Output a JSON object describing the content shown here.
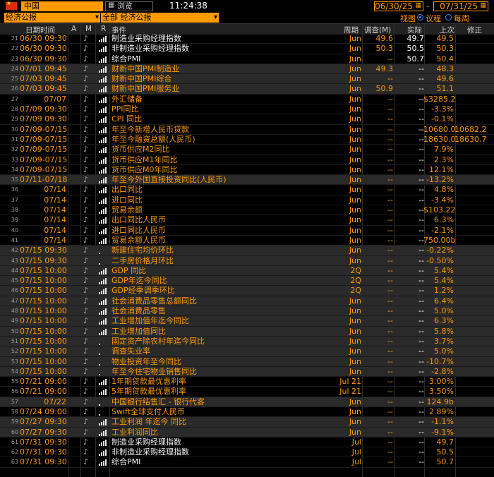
{
  "toolbar": {
    "country": "中国",
    "browse_label": "浏览",
    "time": "11:24:38",
    "date_start": "06/30/25",
    "date_end": "07/31/25",
    "dash": "-",
    "filter_left": "经济公报",
    "filter_right": "全部 经济公报",
    "view_label": "视图",
    "radio_1": "议程",
    "radio_2": "每周"
  },
  "headers": {
    "datetime": "日期时间",
    "a": "A",
    "m": "M",
    "r": "R",
    "event": "事件",
    "period": "周期",
    "survey": "调查(M)",
    "actual": "实际",
    "prior": "上次",
    "revised": "修正"
  },
  "rows": [
    {
      "n": "21",
      "dt": "06/30 09:30",
      "ev": "制造业采购经理指数",
      "c": "w",
      "per": "Jun",
      "sv": "49.6",
      "act": "49.7",
      "prev": "49.5",
      "rev": "",
      "alt": false,
      "bars": true
    },
    {
      "n": "22",
      "dt": "06/30 09:30",
      "ev": "非制造业采购经理指数",
      "c": "w",
      "per": "Jun",
      "sv": "50.3",
      "act": "50.5",
      "prev": "50.3",
      "rev": "",
      "alt": false,
      "bars": true
    },
    {
      "n": "23",
      "dt": "06/30 09:30",
      "ev": "综合PMI",
      "c": "w",
      "per": "Jun",
      "sv": "--",
      "act": "50.7",
      "prev": "50.4",
      "rev": "",
      "alt": false,
      "bars": true
    },
    {
      "n": "24",
      "dt": "07/01 09:45",
      "ev": "财新中国PMI制造业",
      "c": "o",
      "per": "Jun",
      "sv": "49.3",
      "act": "--",
      "prev": "48.3",
      "rev": "",
      "alt": true,
      "bars": true
    },
    {
      "n": "25",
      "dt": "07/03 09:45",
      "ev": "财新中国PMI综合",
      "c": "o",
      "per": "Jun",
      "sv": "--",
      "act": "--",
      "prev": "49.6",
      "rev": "",
      "alt": true,
      "bars": true
    },
    {
      "n": "26",
      "dt": "07/03 09:45",
      "ev": "财新中国PMI服务业",
      "c": "o",
      "per": "Jun",
      "sv": "50.9",
      "act": "--",
      "prev": "51.1",
      "rev": "",
      "alt": true,
      "bars": true
    },
    {
      "n": "27",
      "dt": "07/07",
      "ev": "外汇储备",
      "c": "o",
      "per": "Jun",
      "sv": "--",
      "act": "--",
      "prev": "$3285.2",
      "rev": "",
      "alt": false,
      "bars": true
    },
    {
      "n": "28",
      "dt": "07/09 09:30",
      "ev": "PPI同比",
      "c": "o",
      "per": "Jun",
      "sv": "--",
      "act": "--",
      "prev": "-3.3%",
      "rev": "",
      "alt": false,
      "bars": true
    },
    {
      "n": "29",
      "dt": "07/09 09:30",
      "ev": "CPI 同比",
      "c": "o",
      "per": "Jun",
      "sv": "--",
      "act": "--",
      "prev": "-0.1%",
      "rev": "",
      "alt": false,
      "bars": true
    },
    {
      "n": "30",
      "dt": "07/09-07/15",
      "ev": "年至今新增人民币贷款",
      "c": "o",
      "per": "Jun",
      "sv": "--",
      "act": "--",
      "prev": "10680.0",
      "rev": "10682.2",
      "alt": false,
      "bars": true
    },
    {
      "n": "31",
      "dt": "07/09-07/15",
      "ev": "年至今融资总额(人民币)",
      "c": "o",
      "per": "Jun",
      "sv": "--",
      "act": "--",
      "prev": "18630.0",
      "rev": "18630.7",
      "alt": false,
      "bars": true
    },
    {
      "n": "32",
      "dt": "07/09-07/15",
      "ev": "货币供应M2同比",
      "c": "o",
      "per": "Jun",
      "sv": "--",
      "act": "--",
      "prev": "7.9%",
      "rev": "",
      "alt": false,
      "bars": true
    },
    {
      "n": "33",
      "dt": "07/09-07/15",
      "ev": "货币供应M1年同比",
      "c": "o",
      "per": "Jun",
      "sv": "--",
      "act": "--",
      "prev": "2.3%",
      "rev": "",
      "alt": false,
      "bars": true
    },
    {
      "n": "34",
      "dt": "07/09-07/15",
      "ev": "货币供应M0年同比",
      "c": "o",
      "per": "Jun",
      "sv": "--",
      "act": "--",
      "prev": "12.1%",
      "rev": "",
      "alt": false,
      "bars": true
    },
    {
      "n": "35",
      "dt": "07/11-07/18",
      "ev": "年至今外国直接投资同比(人民币)",
      "c": "o",
      "per": "Jun",
      "sv": "--",
      "act": "--",
      "prev": "-13.2%",
      "rev": "",
      "alt": true,
      "bars": true
    },
    {
      "n": "36",
      "dt": "07/14",
      "ev": "出口同比",
      "c": "o",
      "per": "Jun",
      "sv": "--",
      "act": "--",
      "prev": "4.8%",
      "rev": "",
      "alt": false,
      "bars": true
    },
    {
      "n": "37",
      "dt": "07/14",
      "ev": "进口同比",
      "c": "o",
      "per": "Jun",
      "sv": "--",
      "act": "--",
      "prev": "-3.4%",
      "rev": "",
      "alt": false,
      "bars": true
    },
    {
      "n": "38",
      "dt": "07/14",
      "ev": "贸易余额",
      "c": "o",
      "per": "Jun",
      "sv": "--",
      "act": "--",
      "prev": "$103.22",
      "rev": "",
      "alt": false,
      "bars": true
    },
    {
      "n": "39",
      "dt": "07/14",
      "ev": "出口同比人民币",
      "c": "o",
      "per": "Jun",
      "sv": "--",
      "act": "--",
      "prev": "6.3%",
      "rev": "",
      "alt": false,
      "bars": true
    },
    {
      "n": "40",
      "dt": "07/14",
      "ev": "进口同比人民币",
      "c": "o",
      "per": "Jun",
      "sv": "--",
      "act": "--",
      "prev": "-2.1%",
      "rev": "",
      "alt": false,
      "bars": true
    },
    {
      "n": "41",
      "dt": "07/14",
      "ev": "贸易余额人民币",
      "c": "o",
      "per": "Jun",
      "sv": "--",
      "act": "--",
      "prev": "750.00b",
      "rev": "",
      "alt": false,
      "bars": true
    },
    {
      "n": "42",
      "dt": "07/15 09:30",
      "ev": "新建住宅均价环比",
      "c": "o",
      "per": "Jun",
      "sv": "--",
      "act": "--",
      "prev": "-0.22%",
      "rev": "",
      "alt": true,
      "bars": false
    },
    {
      "n": "43",
      "dt": "07/15 09:30",
      "ev": "二手房价格月环比",
      "c": "o",
      "per": "Jun",
      "sv": "--",
      "act": "--",
      "prev": "-0.50%",
      "rev": "",
      "alt": true,
      "bars": false
    },
    {
      "n": "44",
      "dt": "07/15 10:00",
      "ev": "GDP 同比",
      "c": "o",
      "per": "2Q",
      "sv": "--",
      "act": "--",
      "prev": "5.4%",
      "rev": "",
      "alt": true,
      "bars": true
    },
    {
      "n": "45",
      "dt": "07/15 10:00",
      "ev": "GDP年迄今同比",
      "c": "o",
      "per": "2Q",
      "sv": "--",
      "act": "--",
      "prev": "5.4%",
      "rev": "",
      "alt": true,
      "bars": true
    },
    {
      "n": "46",
      "dt": "07/15 10:00",
      "ev": "GDP经季调季环比",
      "c": "o",
      "per": "2Q",
      "sv": "--",
      "act": "--",
      "prev": "1.2%",
      "rev": "",
      "alt": true,
      "bars": true
    },
    {
      "n": "47",
      "dt": "07/15 10:00",
      "ev": "社会消费品零售总额同比",
      "c": "o",
      "per": "Jun",
      "sv": "--",
      "act": "--",
      "prev": "6.4%",
      "rev": "",
      "alt": true,
      "bars": true
    },
    {
      "n": "48",
      "dt": "07/15 10:00",
      "ev": "社会消费品零售",
      "c": "o",
      "per": "Jun",
      "sv": "--",
      "act": "--",
      "prev": "5.0%",
      "rev": "",
      "alt": true,
      "bars": true
    },
    {
      "n": "49",
      "dt": "07/15 10:00",
      "ev": "工业增加值年迄今同比",
      "c": "o",
      "per": "Jun",
      "sv": "--",
      "act": "--",
      "prev": "6.3%",
      "rev": "",
      "alt": true,
      "bars": true
    },
    {
      "n": "50",
      "dt": "07/15 10:00",
      "ev": "工业增加值同比",
      "c": "o",
      "per": "Jun",
      "sv": "--",
      "act": "--",
      "prev": "5.8%",
      "rev": "",
      "alt": true,
      "bars": true
    },
    {
      "n": "51",
      "dt": "07/15 10:00",
      "ev": "固定资产除农村年迄今同比",
      "c": "o",
      "per": "Jun",
      "sv": "--",
      "act": "--",
      "prev": "3.7%",
      "rev": "",
      "alt": true,
      "bars": false
    },
    {
      "n": "52",
      "dt": "07/15 10:00",
      "ev": "调查失业率",
      "c": "o",
      "per": "Jun",
      "sv": "--",
      "act": "--",
      "prev": "5.0%",
      "rev": "",
      "alt": true,
      "bars": false
    },
    {
      "n": "53",
      "dt": "07/15 10:00",
      "ev": "物业投资年至今同比",
      "c": "o",
      "per": "Jun",
      "sv": "--",
      "act": "--",
      "prev": "-10.7%",
      "rev": "",
      "alt": true,
      "bars": false
    },
    {
      "n": "54",
      "dt": "07/15 10:00",
      "ev": "年至今住宅物业销售同比",
      "c": "o",
      "per": "Jun",
      "sv": "--",
      "act": "--",
      "prev": "-2.8%",
      "rev": "",
      "alt": true,
      "bars": false
    },
    {
      "n": "55",
      "dt": "07/21 09:00",
      "ev": "1年期贷款最优惠利率",
      "c": "o",
      "per": "Jul 21",
      "sv": "--",
      "act": "--",
      "prev": "3.00%",
      "rev": "",
      "alt": false,
      "bars": true
    },
    {
      "n": "56",
      "dt": "07/21 09:00",
      "ev": "5年期贷款最优惠利率",
      "c": "o",
      "per": "Jul 21",
      "sv": "--",
      "act": "--",
      "prev": "3.50%",
      "rev": "",
      "alt": false,
      "bars": true
    },
    {
      "n": "57",
      "dt": "07/22",
      "ev": "中国银行结售汇 - 银行代客",
      "c": "o",
      "per": "Jun",
      "sv": "--",
      "act": "--",
      "prev": "124.9b",
      "rev": "",
      "alt": true,
      "bars": false
    },
    {
      "n": "58",
      "dt": "07/24 09:00",
      "ev": "Swift全球支付人民币",
      "c": "o",
      "per": "Jun",
      "sv": "--",
      "act": "--",
      "prev": "2.89%",
      "rev": "",
      "alt": false,
      "bars": false
    },
    {
      "n": "59",
      "dt": "07/27 09:30",
      "ev": "工业利润 年迄今 同比",
      "c": "o",
      "per": "Jun",
      "sv": "--",
      "act": "--",
      "prev": "-1.1%",
      "rev": "",
      "alt": true,
      "bars": true
    },
    {
      "n": "60",
      "dt": "07/27 09:30",
      "ev": "工业利润同比",
      "c": "o",
      "per": "Jun",
      "sv": "--",
      "act": "--",
      "prev": "-9.1%",
      "rev": "",
      "alt": true,
      "bars": true
    },
    {
      "n": "61",
      "dt": "07/31 09:30",
      "ev": "制造业采购经理指数",
      "c": "w",
      "per": "Jul",
      "sv": "--",
      "act": "--",
      "prev": "49.7",
      "rev": "",
      "alt": false,
      "bars": true
    },
    {
      "n": "62",
      "dt": "07/31 09:30",
      "ev": "非制造业采购经理指数",
      "c": "w",
      "per": "Jul",
      "sv": "--",
      "act": "--",
      "prev": "50.5",
      "rev": "",
      "alt": false,
      "bars": true
    },
    {
      "n": "63",
      "dt": "07/31 09:30",
      "ev": "综合PMI",
      "c": "w",
      "per": "Jul",
      "sv": "--",
      "act": "--",
      "prev": "50.7",
      "rev": "",
      "alt": false,
      "bars": true
    }
  ]
}
